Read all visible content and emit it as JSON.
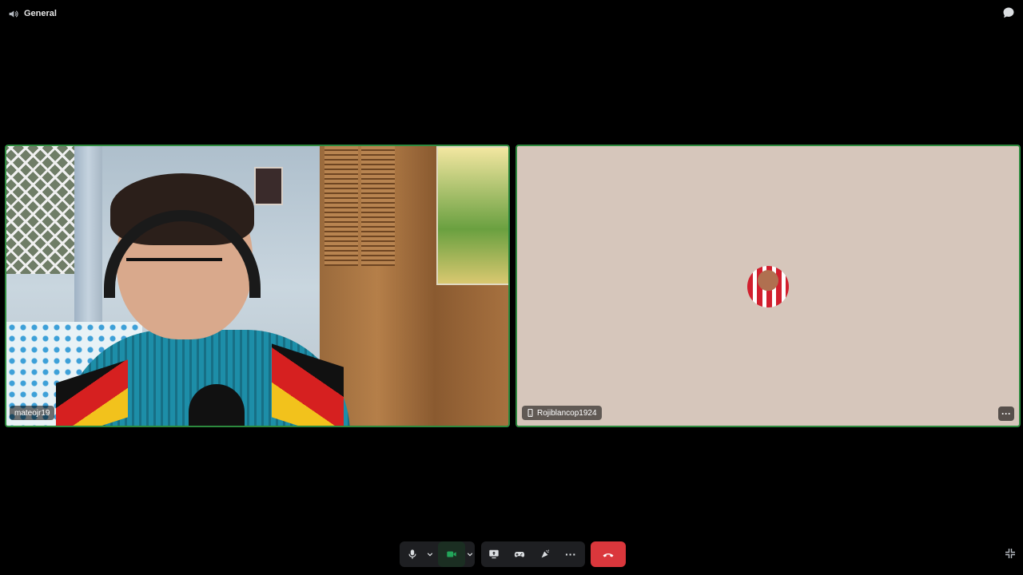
{
  "topbar": {
    "channel_name": "General",
    "channel_icon": "speaker-icon",
    "chat_icon": "chat-bubble-icon"
  },
  "participants": [
    {
      "name": "mateojr19",
      "video": "camera-on"
    },
    {
      "name": "Rojiblancop1924",
      "device_icon": "mobile-phone-icon",
      "video": "avatar"
    }
  ],
  "controls": {
    "mic_icon": "microphone-icon",
    "camera_icon": "camera-icon",
    "share_icon": "screen-share-icon",
    "activity_icon": "gamepad-icon",
    "soundboard_icon": "soundboard-icon",
    "more_icon": "more-icon",
    "more_label": "···",
    "hangup_icon": "hang-up-icon",
    "fullscreen_icon": "exit-fullscreen-icon"
  },
  "colors": {
    "background": "#000000",
    "speaking_border": "#2d8a3e",
    "hangup": "#da373c",
    "camera_on": "#23a55a",
    "avatar_tile_bg": "#d6c6bb"
  }
}
